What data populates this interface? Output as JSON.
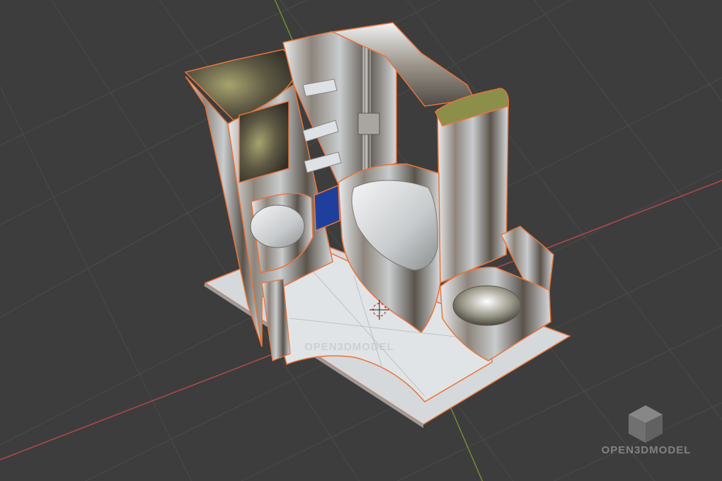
{
  "viewport": {
    "background": "#3d3d3d",
    "grid_color": "#4b4b4b",
    "x_axis_color": "#b04a4a",
    "y_axis_color": "#6f8e33",
    "selection_outline_color": "#e8743a"
  },
  "model": {
    "chrome_color": "#bfc3c6",
    "chrome_dark": "#5c554d",
    "floor_color": "#d6d9dc",
    "towel_color": "#1f3f9c",
    "icons": [
      "3d-cursor-icon",
      "cube-logo-icon"
    ]
  },
  "watermark": {
    "text": "OPEN3DMODEL",
    "floor_text": "OPEN3DMODEL"
  }
}
